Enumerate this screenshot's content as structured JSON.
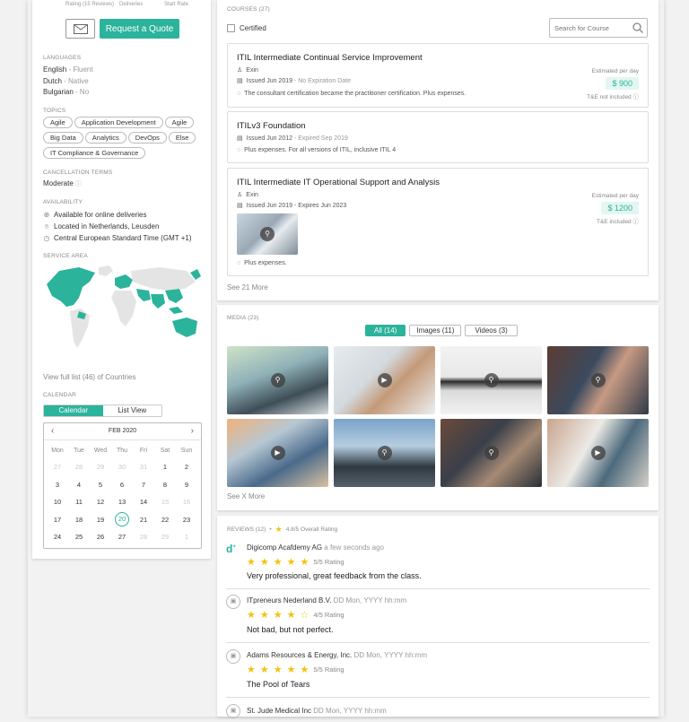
{
  "left": {
    "stats_labels": [
      "Rating (15 Reviews)",
      "Deliveries",
      "Start Rate"
    ],
    "quote_button": "Request a Quote",
    "languages_label": "LANGUAGES",
    "languages": [
      {
        "name": "English",
        "level": "- Fluent"
      },
      {
        "name": "Dutch",
        "level": "- Native"
      },
      {
        "name": "Bulgarian",
        "level": "- No"
      }
    ],
    "topics_label": "TOPICS",
    "topics": [
      "Agile",
      "Application Development",
      "Agile",
      "Big Data",
      "Analytics",
      "DevOps",
      "Else",
      "IT Compliance & Governance"
    ],
    "cancel_label": "CANCELLATION TERMS",
    "cancel_value": "Moderate",
    "availability_label": "AVAILABILITY",
    "availability": [
      "Available for online deliveries",
      "Located in Netherlands, Leusden",
      "Central European Standard Time (GMT +1)"
    ],
    "service_label": "SERVICE AREA",
    "countries_link": "View full list (46) of Countries",
    "calendar_label": "CALENDAR",
    "cal_tabs": [
      "Calendar",
      "List View"
    ],
    "cal_month": "FEB 2020",
    "weekdays": [
      "Mon",
      "Tue",
      "Wed",
      "Thu",
      "Fri",
      "Sat",
      "Sun"
    ],
    "weeks": [
      [
        "27",
        "28",
        "29",
        "30",
        "31",
        "1",
        "2"
      ],
      [
        "3",
        "4",
        "5",
        "6",
        "7",
        "8",
        "9"
      ],
      [
        "10",
        "11",
        "12",
        "13",
        "14",
        "15",
        "16"
      ],
      [
        "17",
        "18",
        "19",
        "20",
        "21",
        "22",
        "23"
      ],
      [
        "24",
        "25",
        "26",
        "27",
        "28",
        "29",
        "1"
      ]
    ]
  },
  "courses": {
    "header": "COURSES (27)",
    "certified_label": "Certified",
    "search_placeholder": "Search for Course",
    "items": [
      {
        "title": "ITIL Intermediate Continual Service Improvement",
        "provider": "Exin",
        "issued": "Issued Jun 2019",
        "expiry": " - No Expiration Date",
        "note": "The consultant certification became the practitioner certification. Plus expenses.",
        "price_label": "Estimated per day",
        "price": "$ 900",
        "tne": "T&E not included"
      },
      {
        "title": "ITILv3 Foundation",
        "issued": "Issued Jun 2012",
        "expiry": " - Expired Sep 2019",
        "note": "Plus expenses. For all versions of ITIL, inclusive ITIL 4"
      },
      {
        "title": "ITIL Intermediate IT Operational Support and Analysis",
        "provider": "Exin",
        "issued": "Issued Jun 2019 - Expires Jun 2023",
        "note": "Plus expenses.",
        "price_label": "Estimated per day",
        "price": "$ 1200",
        "tne": "T&E included"
      }
    ],
    "see_more": "See 21 More"
  },
  "media": {
    "header": "MEDIA (23)",
    "tabs": [
      "All (14)",
      "Images (11)",
      "Videos (3)"
    ],
    "see_more": "See X More"
  },
  "reviews": {
    "header": "REVIEWS (12)",
    "overall": "4.8/5 Overall Rating",
    "items": [
      {
        "author": "Digicomp Acafdemy AG",
        "time": "a few seconds ago",
        "rating_text": "5/5 Rating",
        "stars": 5,
        "text": "Very professional, great feedback from the class."
      },
      {
        "author": "ITpreneurs Nederland B.V.",
        "time": "DD Mon, YYYY hh:mm",
        "rating_text": "4/5 Rating",
        "stars": 4,
        "text": "Not bad, but not perfect."
      },
      {
        "author": "Adams Resources & Energy, Inc.",
        "time": "DD Mon, YYYY hh:mm",
        "rating_text": "5/5 Rating",
        "stars": 5,
        "text": "The Pool of Tears"
      },
      {
        "author": "St. Jude Medical Inc",
        "time": "DD Mon, YYYY hh:mm"
      }
    ]
  },
  "colors": {
    "accent": "#2bb39b",
    "star": "#f3c20b"
  }
}
